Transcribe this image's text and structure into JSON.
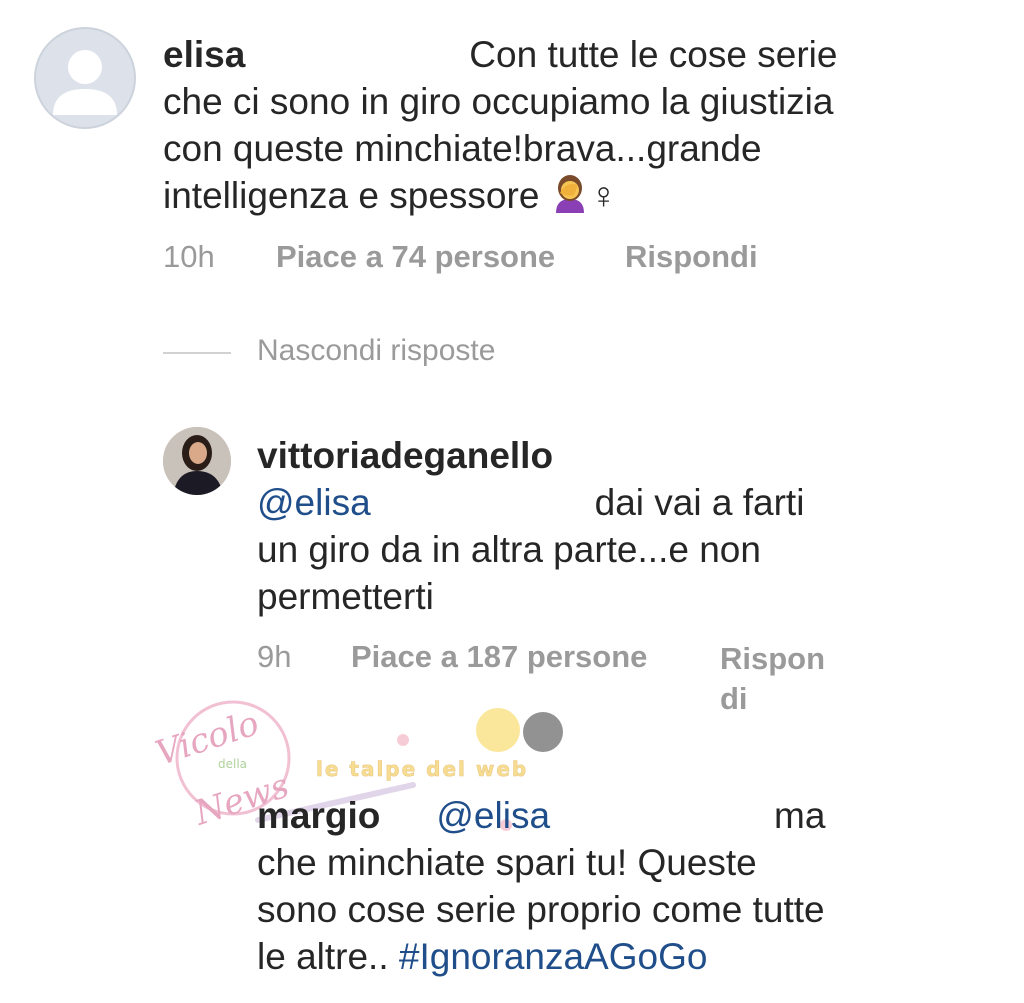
{
  "comments": [
    {
      "username": "elisa",
      "text_first": "Con tutte le cose serie",
      "text_lines": [
        "che ci sono in giro occupiamo la giustizia",
        "con queste minchiate!brava...grande",
        "intelligenza e spessore"
      ],
      "emoji": "facepalm-woman-icon",
      "gender_sign": "♀",
      "time": "10h",
      "likes": "Piace a 74 persone",
      "reply": "Rispondi"
    }
  ],
  "replies_toggle": "Nascondi risposte",
  "replies": [
    {
      "username": "vittoriadeganello",
      "mention": "@elisa",
      "text_first": "dai vai a farti",
      "text_lines": [
        "un giro da in altra parte...e non",
        "permetterti"
      ],
      "time": "9h",
      "likes": "Piace a 187 persone",
      "reply_part1": "Rispon",
      "reply_part2": "di"
    },
    {
      "username": "margio",
      "mention": "@elisa",
      "text_first": "ma",
      "text_lines": [
        "che minchiate spari tu! Queste",
        "sono cose serie proprio come tutte"
      ],
      "last_line_text": "le altre..",
      "hashtag": "#IgnoranzaAGoGo"
    }
  ],
  "watermark": {
    "stamp_line1": "Vicolo",
    "stamp_line2": "della",
    "stamp_line3": "News",
    "banner": "le talpe del web"
  },
  "colors": {
    "mention": "#1f4e8a",
    "meta": "#9a9a9a",
    "text": "#262626"
  }
}
